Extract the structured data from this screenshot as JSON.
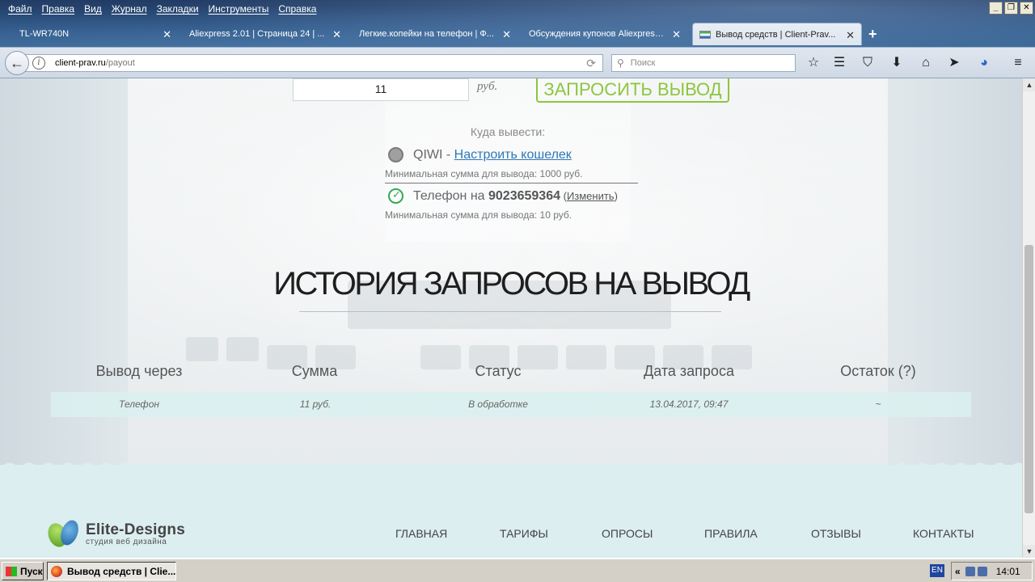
{
  "menubar": [
    "Файл",
    "Правка",
    "Вид",
    "Журнал",
    "Закладки",
    "Инструменты",
    "Справка"
  ],
  "tabs": [
    {
      "title": "TL-WR740N",
      "active": false
    },
    {
      "title": "Aliexpress 2.01 | Страница 24 | ...",
      "active": false
    },
    {
      "title": "Легкие.копейки на телефон | Ф...",
      "active": false
    },
    {
      "title": "Обсуждения купонов Aliexpress ...",
      "active": false
    },
    {
      "title": "Вывод средств | Client-Prav...",
      "active": true
    }
  ],
  "address": {
    "host": "client-prav.ru",
    "path": "/payout"
  },
  "search": {
    "placeholder": "Поиск"
  },
  "toolbar_icons": [
    "star-icon",
    "reading-list-icon",
    "pocket-icon",
    "download-icon",
    "home-icon",
    "send-icon",
    "extension-icon",
    "hamburger-menu-icon"
  ],
  "payout": {
    "amount": "11",
    "currency_label": "руб.",
    "request_button": "ЗАПРОСИТЬ ВЫВОД",
    "destination_label": "Куда вывести:",
    "options": [
      {
        "name": "QIWI",
        "separator": " - ",
        "link": "Настроить кошелек",
        "min_sum": "Минимальная сумма для вывода: 1000 руб.",
        "selected": false
      },
      {
        "name": "Телефон на ",
        "phone": "9023659364",
        "change_open": " (",
        "change": "Изменить",
        "change_close": ")",
        "min_sum": "Минимальная сумма для вывода: 10 руб.",
        "selected": true
      }
    ]
  },
  "history": {
    "title": "ИСТОРИЯ ЗАПРОСОВ НА ВЫВОД",
    "columns": [
      "Вывод через",
      "Сумма",
      "Статус",
      "Дата запроса",
      "Остаток (?)"
    ],
    "rows": [
      [
        "Телефон",
        "11 руб.",
        "В обработке",
        "13.04.2017, 09:47",
        "~"
      ]
    ]
  },
  "footer": {
    "brand": "Elite-Designs",
    "tagline": "студия веб дизайна",
    "nav": [
      "ГЛАВНАЯ",
      "ТАРИФЫ",
      "ОПРОСЫ",
      "ПРАВИЛА",
      "ОТЗЫВЫ",
      "КОНТАКТЫ"
    ]
  },
  "taskbar": {
    "start": "Пуск",
    "task": "Вывод средств | Clie...",
    "lang": "EN",
    "tray_chevron": "«",
    "clock": "14:01"
  }
}
